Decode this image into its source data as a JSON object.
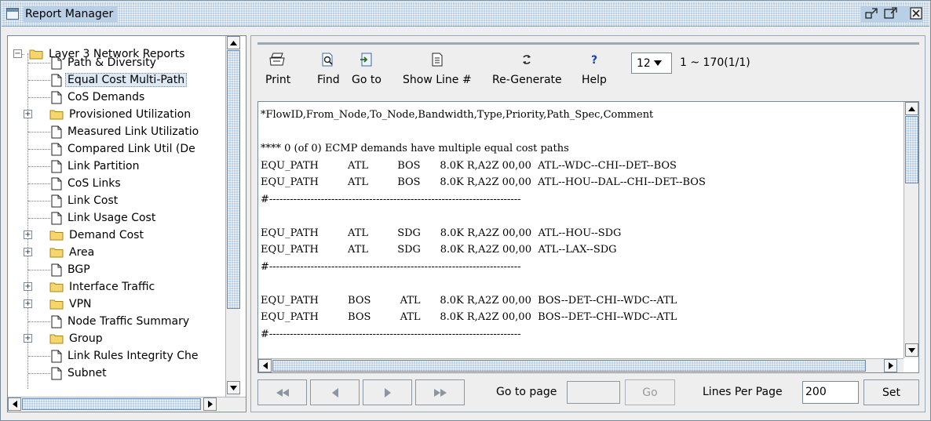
{
  "window": {
    "title": "Report Manager"
  },
  "tree": {
    "root": "Layer 3 Network Reports",
    "items": [
      {
        "label": "Path & Diversity",
        "kind": "doc"
      },
      {
        "label": "Equal Cost Multi-Path",
        "kind": "doc",
        "selected": true
      },
      {
        "label": "CoS Demands",
        "kind": "doc"
      },
      {
        "label": "Provisioned Utilization",
        "kind": "folder"
      },
      {
        "label": "Measured Link Utilizatio",
        "kind": "doc"
      },
      {
        "label": "Compared Link Util (De",
        "kind": "doc"
      },
      {
        "label": "Link Partition",
        "kind": "doc"
      },
      {
        "label": "CoS Links",
        "kind": "doc"
      },
      {
        "label": "Link Cost",
        "kind": "doc"
      },
      {
        "label": "Link Usage Cost",
        "kind": "doc"
      },
      {
        "label": "Demand Cost",
        "kind": "folder"
      },
      {
        "label": "Area",
        "kind": "folder"
      },
      {
        "label": "BGP",
        "kind": "doc"
      },
      {
        "label": "Interface Traffic",
        "kind": "folder"
      },
      {
        "label": "VPN",
        "kind": "folder"
      },
      {
        "label": "Node Traffic Summary",
        "kind": "doc"
      },
      {
        "label": "Group",
        "kind": "folder"
      },
      {
        "label": "Link Rules Integrity Che",
        "kind": "doc"
      },
      {
        "label": "Subnet",
        "kind": "doc"
      }
    ]
  },
  "toolbar": {
    "print": "Print",
    "find": "Find",
    "goto": "Go to",
    "show_line": "Show Line #",
    "regenerate": "Re-Generate",
    "help": "Help",
    "page_select": "12",
    "range": "1 ~ 170(1/1)"
  },
  "report": {
    "lines": [
      "*FlowID,From_Node,To_Node,Bandwidth,Type,Priority,Path_Spec,Comment",
      "",
      "**** 0 (of 0) ECMP demands have multiple equal cost paths",
      "EQU_PATH         ATL         BOS      8.0K R,A2Z 00,00  ATL--WDC--CHI--DET--BOS",
      "EQU_PATH         ATL         BOS      8.0K R,A2Z 00,00  ATL--HOU--DAL--CHI--DET--BOS",
      "#-------------------------------------------------------------------------",
      "",
      "EQU_PATH         ATL         SDG      8.0K R,A2Z 00,00  ATL--HOU--SDG",
      "EQU_PATH         ATL         SDG      8.0K R,A2Z 00,00  ATL--LAX--SDG",
      "#-------------------------------------------------------------------------",
      "",
      "EQU_PATH         BOS         ATL      8.0K R,A2Z 00,00  BOS--DET--CHI--WDC--ATL",
      "EQU_PATH         BOS         ATL      8.0K R,A2Z 00,00  BOS--DET--CHI--WDC--ATL",
      "#-------------------------------------------------------------------------"
    ]
  },
  "nav": {
    "goto_label": "Go to page",
    "goto_value": "",
    "go_label": "Go",
    "lines_per_page_label": "Lines Per Page",
    "lines_per_page_value": "200",
    "set_label": "Set"
  }
}
